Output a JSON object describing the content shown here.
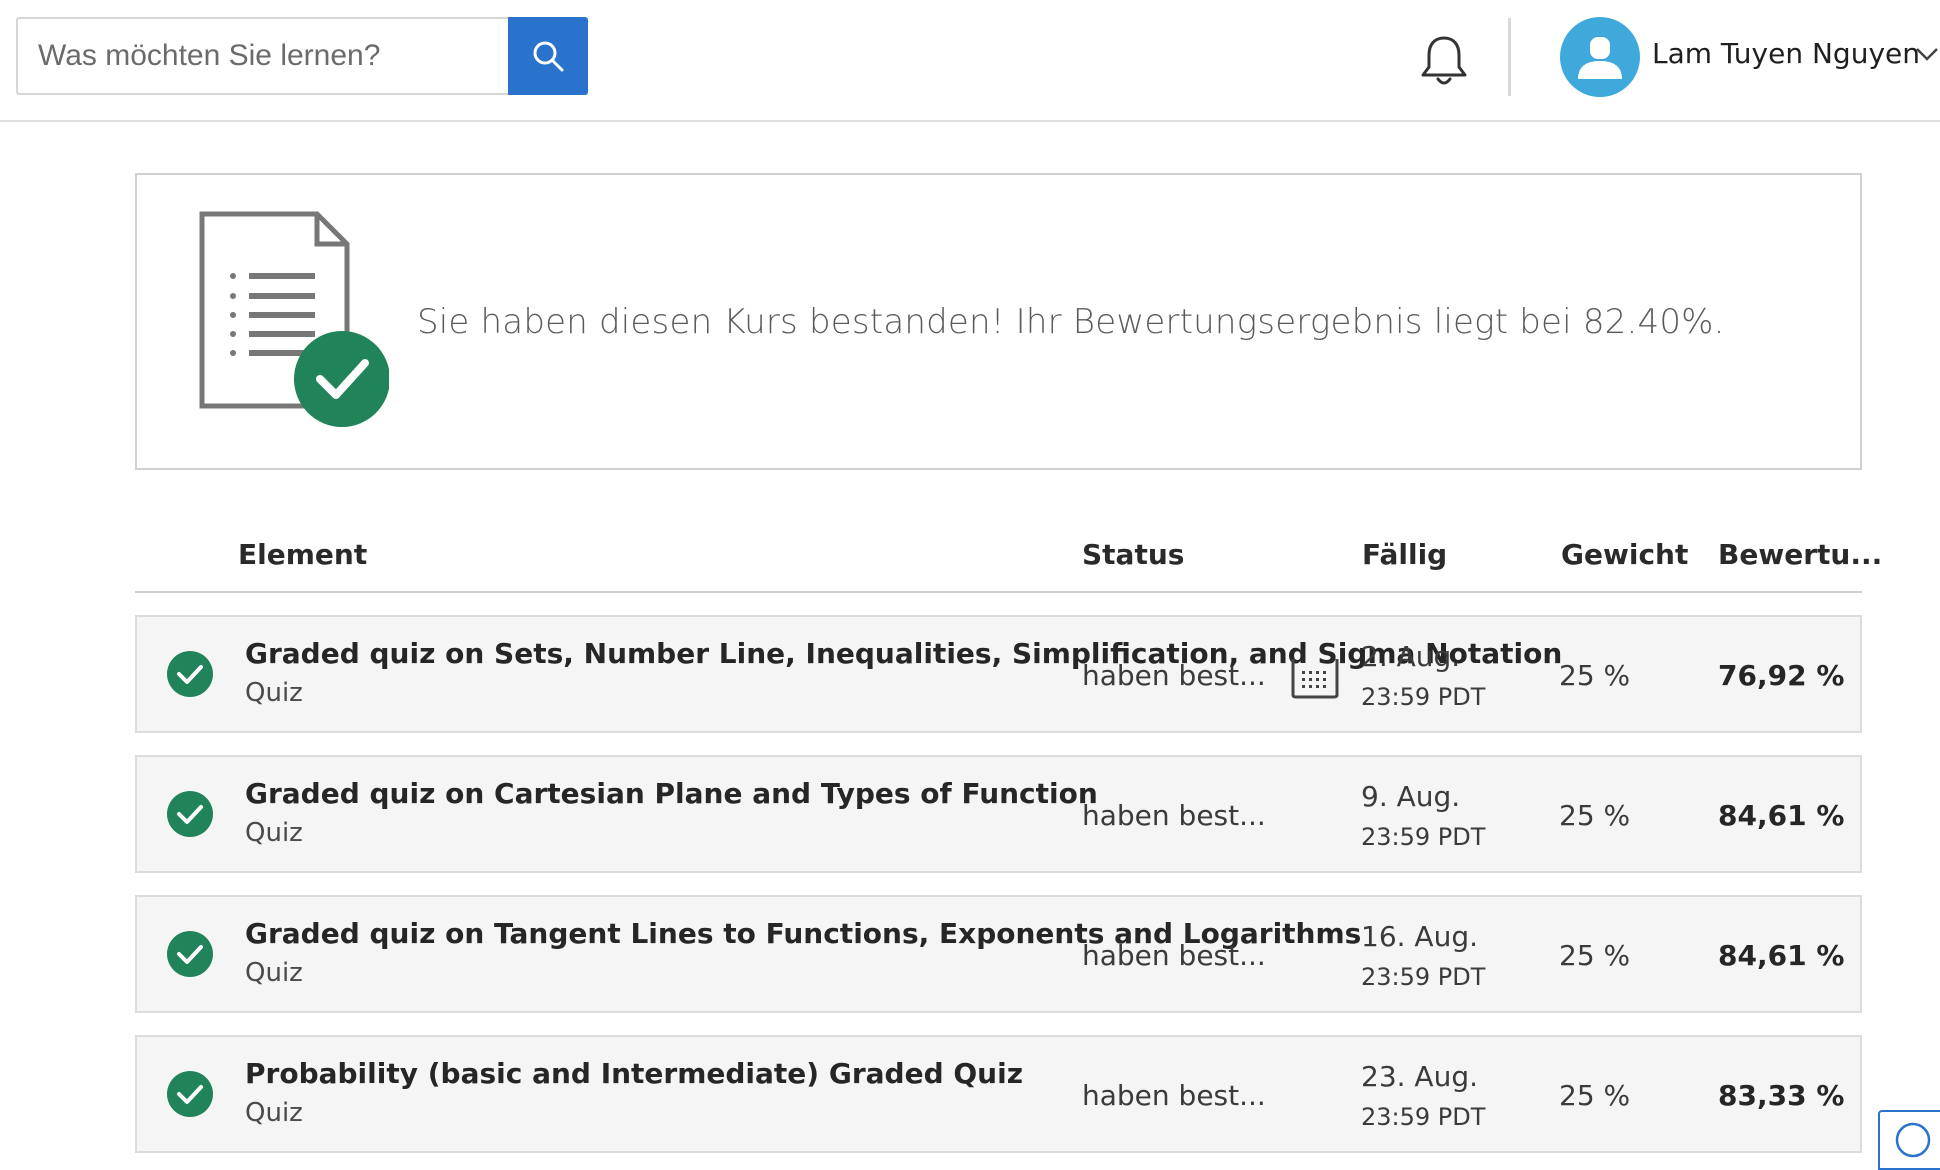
{
  "header": {
    "search": {
      "placeholder": "Was möchten Sie lernen?",
      "value": ""
    },
    "user": {
      "name": "Lam Tuyen Nguyen"
    }
  },
  "banner": {
    "message": "Sie haben diesen Kurs bestanden! Ihr Bewertungsergebnis liegt bei 82.40%."
  },
  "table": {
    "columns": {
      "element": "Element",
      "status": "Status",
      "due": "Fällig",
      "weight": "Gewicht",
      "grade": "Bewertu..."
    },
    "rows": [
      {
        "title": "Graded quiz on Sets, Number Line, Inequalities, Simplification, and Sigma Notation",
        "type": "Quiz",
        "status": "haben best...",
        "due_date": "2. Aug.",
        "due_time": "23:59 PDT",
        "weight": "25 %",
        "grade": "76,92 %"
      },
      {
        "title": "Graded quiz on Cartesian Plane and Types of Function",
        "type": "Quiz",
        "status": "haben best...",
        "due_date": "9. Aug.",
        "due_time": "23:59 PDT",
        "weight": "25 %",
        "grade": "84,61 %"
      },
      {
        "title": "Graded quiz on Tangent Lines to Functions, Exponents and Logarithms",
        "type": "Quiz",
        "status": "haben best...",
        "due_date": "16. Aug.",
        "due_time": "23:59 PDT",
        "weight": "25 %",
        "grade": "84,61 %"
      },
      {
        "title": "Probability (basic and Intermediate) Graded Quiz",
        "type": "Quiz",
        "status": "haben best...",
        "due_date": "23. Aug.",
        "due_time": "23:59 PDT",
        "weight": "25 %",
        "grade": "83,33 %"
      }
    ]
  },
  "help": {
    "label": "?"
  },
  "icons": {
    "search": "search-icon",
    "bell": "bell-icon",
    "avatar": "user-avatar-icon",
    "chevron": "chevron-down-icon",
    "document": "document-check-icon",
    "check": "check-circle-icon",
    "calendar": "calendar-icon"
  },
  "colors": {
    "accent": "#2a73cc",
    "success": "#21835a",
    "avatar": "#3fa9dc"
  }
}
